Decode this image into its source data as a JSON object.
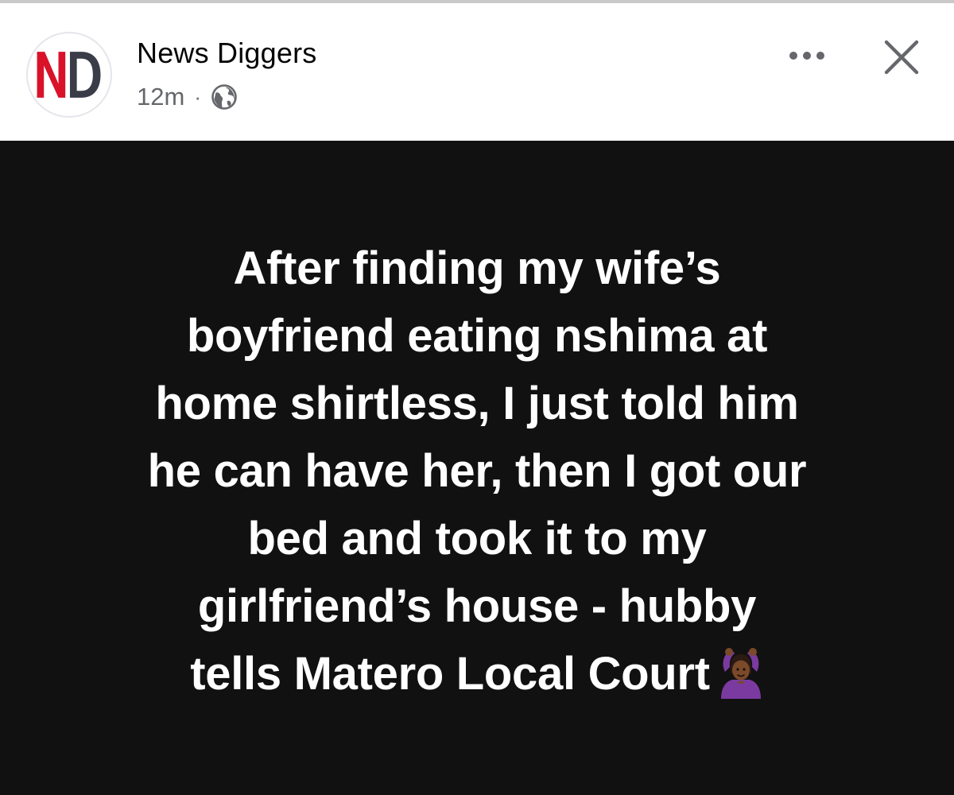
{
  "header": {
    "avatar_monogram": "ND",
    "page_name": "News Diggers",
    "timestamp": "12m",
    "separator": "·",
    "audience_icon": "globe-icon",
    "more_icon": "more-horizontal-icon",
    "close_icon": "close-icon"
  },
  "post": {
    "lines": [
      "After finding my wife’s",
      "boyfriend eating nshima at",
      "home shirtless, I just told him",
      "he can have her, then I got our",
      "bed and took it to my",
      "girlfriend’s house - hubby",
      "tells Matero Local Court"
    ],
    "emoji_icon": "person-gesturing-ok-icon"
  },
  "colors": {
    "monogram_n": "#d9122a",
    "monogram_d": "#3a3d48",
    "post_background": "#111111",
    "post_text": "#ffffff",
    "secondary_text": "#65676b",
    "emoji_shirt": "#7b3aa0",
    "emoji_skin": "#7a4a2a"
  }
}
